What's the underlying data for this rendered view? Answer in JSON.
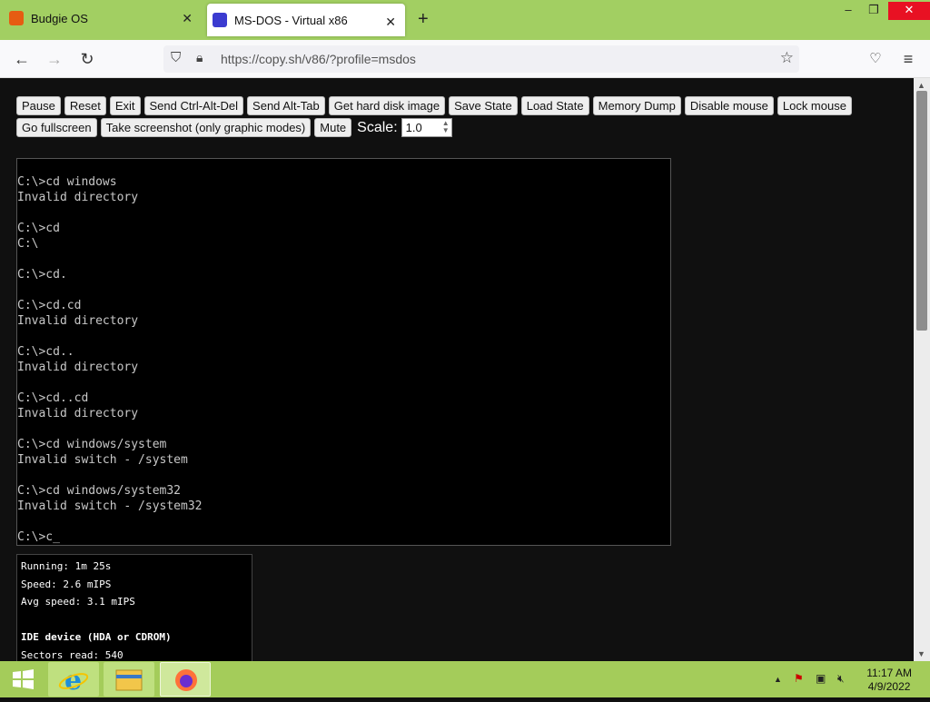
{
  "browser": {
    "tabs": [
      {
        "title": "Budgie OS",
        "favicon_color": "#e65c12",
        "active": false
      },
      {
        "title": "MS-DOS - Virtual x86",
        "favicon_color": "#3b3bd0",
        "active": true
      }
    ],
    "new_tab": "+",
    "url": "https://copy.sh/v86/?profile=msdos",
    "window_controls": {
      "minimize": "–",
      "restore": "❐",
      "close": "✕"
    }
  },
  "toolbar": {
    "row1": [
      "Pause",
      "Reset",
      "Exit",
      "Send Ctrl-Alt-Del",
      "Send Alt-Tab",
      "Get hard disk image",
      "Save State",
      "Load State",
      "Memory Dump",
      "Disable mouse",
      "Lock mouse"
    ],
    "row2": [
      "Go fullscreen",
      "Take screenshot (only graphic modes)",
      "Mute"
    ],
    "scale_label": "Scale:",
    "scale_value": "1.0"
  },
  "terminal": {
    "lines": [
      "",
      "C:\\>cd windows",
      "Invalid directory",
      "",
      "C:\\>cd",
      "C:\\",
      "",
      "C:\\>cd.",
      "",
      "C:\\>cd.cd",
      "Invalid directory",
      "",
      "C:\\>cd..",
      "Invalid directory",
      "",
      "C:\\>cd..cd",
      "Invalid directory",
      "",
      "C:\\>cd windows/system",
      "Invalid switch - /system",
      "",
      "C:\\>cd windows/system32",
      "Invalid switch - /system32",
      "",
      "C:\\>c_"
    ]
  },
  "info": {
    "running": "Running: 1m 25s",
    "speed": "Speed: 2.6 mIPS",
    "avg_speed": "Avg speed: 3.1 mIPS",
    "ide_header": "IDE device (HDA or CDROM)",
    "sectors_read": "Sectors read: 540"
  },
  "taskbar": {
    "time": "11:17 AM",
    "date": "4/9/2022",
    "items": [
      "start-button",
      "ie-icon",
      "file-explorer-icon",
      "firefox-icon"
    ]
  }
}
